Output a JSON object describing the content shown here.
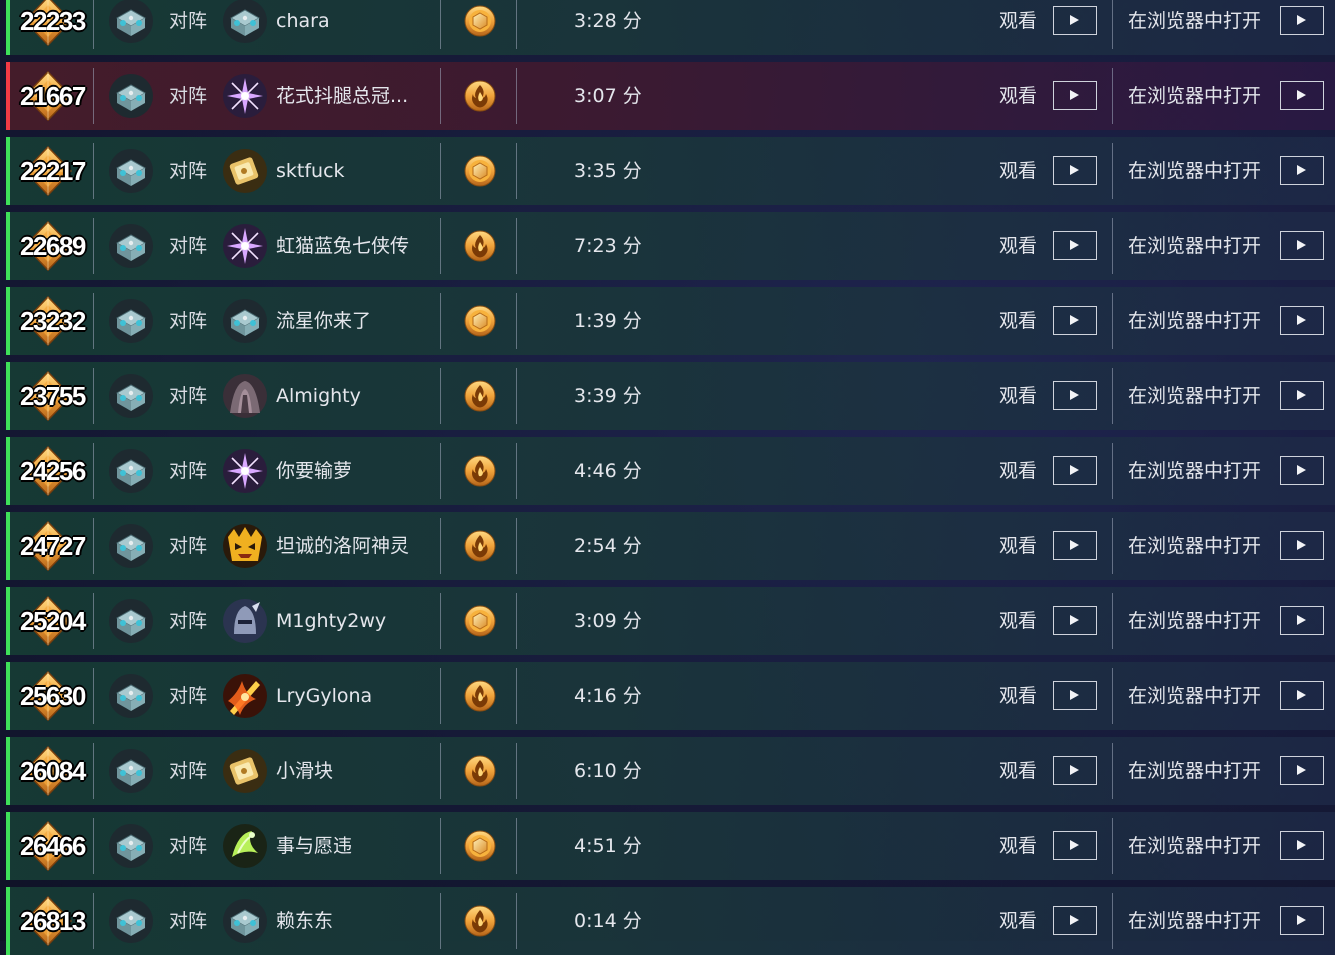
{
  "labels": {
    "versus": "对阵",
    "watch": "观看",
    "open_in_browser": "在浏览器中打开",
    "duration_unit": "分"
  },
  "colors": {
    "win_indicator": "#3fe05a",
    "loss_indicator": "#f23b45",
    "accent_gold": "#f3a53a"
  },
  "matches": [
    {
      "rank": "22233",
      "result": "win",
      "player_icon": "mech-hero-icon",
      "opponent": "chara",
      "opponent_icon": "mech-hero-icon",
      "mode": "coin",
      "duration": "3:28 分"
    },
    {
      "rank": "21667",
      "result": "loss",
      "player_icon": "mech-hero-icon",
      "opponent": "花式抖腿总冠...",
      "opponent_icon": "purple-star-hero-icon",
      "mode": "flame",
      "duration": "3:07 分"
    },
    {
      "rank": "22217",
      "result": "win",
      "player_icon": "mech-hero-icon",
      "opponent": "sktfuck",
      "opponent_icon": "golden-box-hero-icon",
      "mode": "coin",
      "duration": "3:35 分"
    },
    {
      "rank": "22689",
      "result": "win",
      "player_icon": "mech-hero-icon",
      "opponent": "虹猫蓝兔七侠传",
      "opponent_icon": "purple-star-hero-icon",
      "mode": "flame",
      "duration": "7:23 分"
    },
    {
      "rank": "23232",
      "result": "win",
      "player_icon": "mech-hero-icon",
      "opponent": "流星你来了",
      "opponent_icon": "mech-hero-icon",
      "mode": "coin",
      "duration": "1:39 分"
    },
    {
      "rank": "23755",
      "result": "win",
      "player_icon": "mech-hero-icon",
      "opponent": "Almighty",
      "opponent_icon": "cloaked-hero-icon",
      "mode": "flame",
      "duration": "3:39 分"
    },
    {
      "rank": "24256",
      "result": "win",
      "player_icon": "mech-hero-icon",
      "opponent": "你要输萝",
      "opponent_icon": "purple-star-hero-icon",
      "mode": "flame",
      "duration": "4:46 分"
    },
    {
      "rank": "24727",
      "result": "win",
      "player_icon": "mech-hero-icon",
      "opponent": "坦诚的洛阿神灵",
      "opponent_icon": "tribal-mask-hero-icon",
      "mode": "flame",
      "duration": "2:54 分"
    },
    {
      "rank": "25204",
      "result": "win",
      "player_icon": "mech-hero-icon",
      "opponent": "M1ghty2wy",
      "opponent_icon": "knight-hero-icon",
      "mode": "coin",
      "duration": "3:09 分"
    },
    {
      "rank": "25630",
      "result": "win",
      "player_icon": "mech-hero-icon",
      "opponent": "LryGylona",
      "opponent_icon": "fire-blade-hero-icon",
      "mode": "flame",
      "duration": "4:16 分"
    },
    {
      "rank": "26084",
      "result": "win",
      "player_icon": "mech-hero-icon",
      "opponent": "小滑块",
      "opponent_icon": "golden-box-hero-icon",
      "mode": "flame",
      "duration": "6:10 分"
    },
    {
      "rank": "26466",
      "result": "win",
      "player_icon": "mech-hero-icon",
      "opponent": "事与愿违",
      "opponent_icon": "green-spirit-hero-icon",
      "mode": "coin",
      "duration": "4:51 分"
    },
    {
      "rank": "26813",
      "result": "win",
      "player_icon": "mech-hero-icon",
      "opponent": "赖东东",
      "opponent_icon": "mech-hero-icon",
      "mode": "flame",
      "duration": "0:14 分"
    }
  ]
}
